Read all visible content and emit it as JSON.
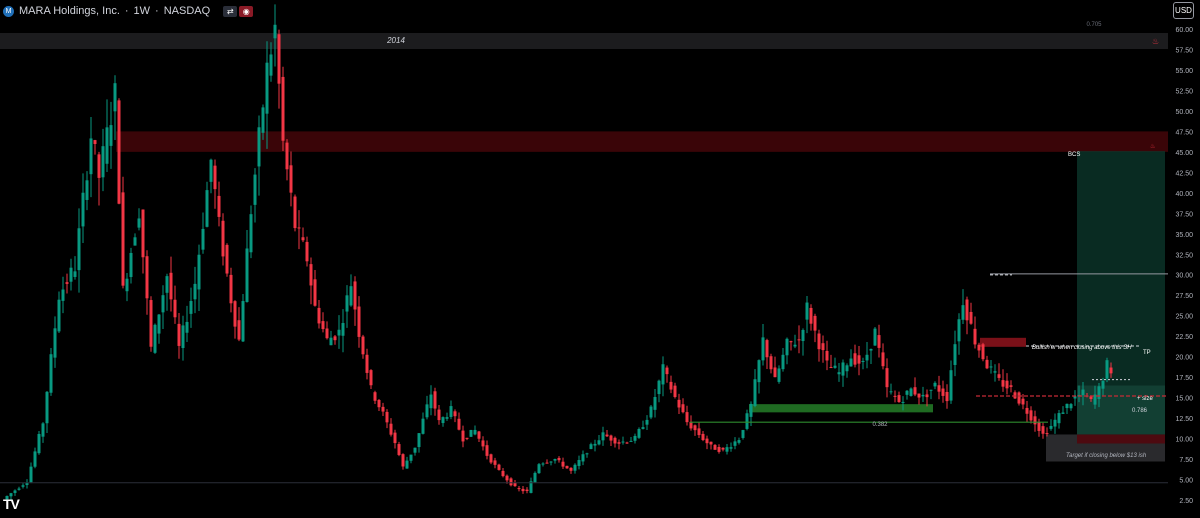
{
  "header": {
    "logo_icon": "mara-logo-icon",
    "symbol": "MARA Holdings, Inc.",
    "interval": "1W",
    "exchange": "NASDAQ",
    "separator": " · "
  },
  "currency": "USD",
  "brand": "TV",
  "colors": {
    "up": "#089981",
    "down": "#f23645",
    "text": "#d1d4dc",
    "axis_text": "#b2b5be",
    "resistance_zone": "#3a0508",
    "green_zone": "#0c3a2e",
    "support_bar": "#1f6b22",
    "stop_zone": "#4d0a10",
    "dark_band": "#1c1c1e"
  },
  "chart_data": {
    "type": "candlestick",
    "timeframe": "1W",
    "ylim": [
      1.8,
      63
    ],
    "y_ticks": [
      "60.00",
      "57.50",
      "55.00",
      "52.50",
      "50.00",
      "47.50",
      "45.00",
      "42.50",
      "40.00",
      "37.50",
      "35.00",
      "32.50",
      "30.00",
      "27.50",
      "25.00",
      "22.50",
      "20.00",
      "17.50",
      "15.00",
      "12.50",
      "10.00",
      "7.50",
      "5.00",
      "2.50"
    ],
    "annotations": {
      "year_label": "2014",
      "fib_top": "0.705",
      "fib_382": "0.382",
      "fib_786": "0.786",
      "bcs": "BCS",
      "tp": "TP",
      "size": "+ size",
      "bullish_note": "Bullish'er when closing above this SH",
      "target_note": "Target if closing below $13 ish"
    },
    "zones": [
      {
        "name": "resistance",
        "y1": 45.0,
        "y2": 47.5
      },
      {
        "name": "support",
        "y1": 13.2,
        "y2": 14.2
      },
      {
        "name": "stop",
        "y1": 9.4,
        "y2": 10.5
      },
      {
        "name": "target",
        "y1": 7.2,
        "y2": 10.5
      }
    ],
    "levels": [
      {
        "name": "swing_high",
        "y": 30.1
      },
      {
        "name": "bullish_sh",
        "y": 21.3
      },
      {
        "name": "breakdown",
        "y": 15.2
      },
      {
        "name": "fib_382",
        "y": 12.0
      }
    ],
    "anchors": [
      {
        "i": 0,
        "c": 2.6
      },
      {
        "i": 6,
        "c": 4.8
      },
      {
        "i": 10,
        "c": 12.0
      },
      {
        "i": 14,
        "c": 27.5
      },
      {
        "i": 18,
        "c": 31.0
      },
      {
        "i": 22,
        "c": 47.0
      },
      {
        "i": 24,
        "c": 42.0
      },
      {
        "i": 28,
        "c": 52.0
      },
      {
        "i": 30,
        "c": 28.0
      },
      {
        "i": 34,
        "c": 38.0
      },
      {
        "i": 37,
        "c": 21.0
      },
      {
        "i": 41,
        "c": 30.0
      },
      {
        "i": 44,
        "c": 21.0
      },
      {
        "i": 48,
        "c": 29.0
      },
      {
        "i": 52,
        "c": 44.0
      },
      {
        "i": 54,
        "c": 36.0
      },
      {
        "i": 57,
        "c": 27.0
      },
      {
        "i": 59,
        "c": 22.0
      },
      {
        "i": 62,
        "c": 38.0
      },
      {
        "i": 66,
        "c": 55.0
      },
      {
        "i": 68,
        "c": 60.0
      },
      {
        "i": 70,
        "c": 46.0
      },
      {
        "i": 73,
        "c": 36.0
      },
      {
        "i": 76,
        "c": 32.0
      },
      {
        "i": 78,
        "c": 26.0
      },
      {
        "i": 81,
        "c": 22.0
      },
      {
        "i": 84,
        "c": 23.0
      },
      {
        "i": 87,
        "c": 29.0
      },
      {
        "i": 89,
        "c": 23.0
      },
      {
        "i": 92,
        "c": 16.0
      },
      {
        "i": 95,
        "c": 13.0
      },
      {
        "i": 98,
        "c": 9.5
      },
      {
        "i": 100,
        "c": 6.5
      },
      {
        "i": 103,
        "c": 9.0
      },
      {
        "i": 107,
        "c": 15.5
      },
      {
        "i": 109,
        "c": 12.0
      },
      {
        "i": 112,
        "c": 13.5
      },
      {
        "i": 115,
        "c": 10.0
      },
      {
        "i": 118,
        "c": 11.0
      },
      {
        "i": 121,
        "c": 8.0
      },
      {
        "i": 124,
        "c": 6.0
      },
      {
        "i": 128,
        "c": 4.0
      },
      {
        "i": 131,
        "c": 3.5
      },
      {
        "i": 134,
        "c": 7.0
      },
      {
        "i": 138,
        "c": 7.5
      },
      {
        "i": 142,
        "c": 6.0
      },
      {
        "i": 146,
        "c": 8.5
      },
      {
        "i": 150,
        "c": 10.5
      },
      {
        "i": 154,
        "c": 9.5
      },
      {
        "i": 158,
        "c": 10.0
      },
      {
        "i": 162,
        "c": 13.5
      },
      {
        "i": 165,
        "c": 18.5
      },
      {
        "i": 168,
        "c": 15.0
      },
      {
        "i": 171,
        "c": 12.0
      },
      {
        "i": 174,
        "c": 10.5
      },
      {
        "i": 177,
        "c": 9.0
      },
      {
        "i": 180,
        "c": 8.5
      },
      {
        "i": 184,
        "c": 10.0
      },
      {
        "i": 187,
        "c": 14.0
      },
      {
        "i": 190,
        "c": 22.0
      },
      {
        "i": 193,
        "c": 17.0
      },
      {
        "i": 196,
        "c": 21.5
      },
      {
        "i": 199,
        "c": 22.0
      },
      {
        "i": 201,
        "c": 26.0
      },
      {
        "i": 203,
        "c": 23.0
      },
      {
        "i": 206,
        "c": 19.0
      },
      {
        "i": 209,
        "c": 18.0
      },
      {
        "i": 212,
        "c": 20.0
      },
      {
        "i": 215,
        "c": 19.0
      },
      {
        "i": 218,
        "c": 23.0
      },
      {
        "i": 221,
        "c": 16.0
      },
      {
        "i": 224,
        "c": 14.5
      },
      {
        "i": 227,
        "c": 16.0
      },
      {
        "i": 230,
        "c": 15.0
      },
      {
        "i": 233,
        "c": 16.5
      },
      {
        "i": 236,
        "c": 15.0
      },
      {
        "i": 238,
        "c": 22.0
      },
      {
        "i": 240,
        "c": 27.0
      },
      {
        "i": 243,
        "c": 22.0
      },
      {
        "i": 246,
        "c": 19.0
      },
      {
        "i": 249,
        "c": 17.0
      },
      {
        "i": 252,
        "c": 16.0
      },
      {
        "i": 255,
        "c": 14.0
      },
      {
        "i": 258,
        "c": 12.0
      },
      {
        "i": 260,
        "c": 10.5
      },
      {
        "i": 262,
        "c": 11.5
      },
      {
        "i": 265,
        "c": 13.5
      },
      {
        "i": 268,
        "c": 15.0
      },
      {
        "i": 270,
        "c": 15.5
      },
      {
        "i": 272,
        "c": 14.5
      },
      {
        "i": 274,
        "c": 16.0
      },
      {
        "i": 276,
        "c": 19.0
      },
      {
        "i": 277,
        "c": 17.5
      }
    ]
  }
}
